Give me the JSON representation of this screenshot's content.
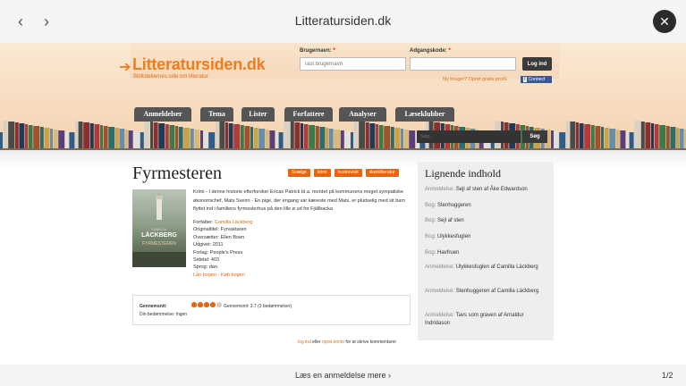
{
  "viewer": {
    "title": "Litteratursiden.dk",
    "prev_icon": "‹",
    "next_icon": "›",
    "close_icon": "✕",
    "bottom_link": "Læs en anmeldelse mere ›",
    "page_counter": "1/2"
  },
  "header": {
    "logo": "Litteratursiden.dk",
    "logo_arrow": "➔",
    "tagline": "Bibliotekernes side om litteratur",
    "username_label": "Brugernavn:",
    "username_placeholder": "Tast brugernavn",
    "password_label": "Adgangskode:",
    "required_mark": "*",
    "login_button": "Log ind",
    "new_user_link": "Ny bruger? Opret gratis profil.",
    "facebook_label": "f",
    "facebook_text": "Connect",
    "search_placeholder": "Søg...",
    "search_button": "Søg"
  },
  "menu": {
    "tabs": [
      "Anmeldelser",
      "Tema",
      "Lister",
      "Forfattere",
      "Analyser",
      "Læseklubber"
    ]
  },
  "book": {
    "title": "Fyrmesteren",
    "tags": [
      "Svælge",
      "krimi",
      "hustrevold",
      "skønlitteratur"
    ],
    "cover_firstname": "CAMILLA",
    "cover_author": "LÄCKBERG",
    "cover_title": "FYRMESTEREN",
    "description": "Krimi - I denne historie efterforsker Ericas Patrick bl.a. mordet på kommunens meget sympatiske økonomichef, Mats Sverin - En pige, der engang var kæreste med Mats, er pludselig med sit barn flyttet ind i familiens fyrmesterhus på den lille ø ud for Fjällbacka",
    "meta": [
      {
        "label": "Forfatter:",
        "value": "Camilla Läckberg",
        "link": true
      },
      {
        "label": "Originaltitel:",
        "value": "Fyrvaktaren",
        "link": false
      },
      {
        "label": "Oversætter:",
        "value": "Ellen Boen",
        "link": false
      },
      {
        "label": "Udgivet:",
        "value": "2011",
        "link": false
      },
      {
        "label": "Forlag:",
        "value": "People's Press",
        "link": false
      },
      {
        "label": "Sidetal:",
        "value": "403",
        "link": false
      },
      {
        "label": "Sprog:",
        "value": "dan",
        "link": false
      }
    ],
    "borrow_link": "Lån bogen",
    "separator": " - ",
    "buy_link": "Køb bogen"
  },
  "rating": {
    "label": "Gennemsnit:",
    "stars_filled": 4,
    "stars_total": 5,
    "average_text": "Gennemsnit: 3.7 (3 bedømmelser)",
    "no_rating_text": "Din bedømmelse: Ingen"
  },
  "comment_note": {
    "login_link": "log ind",
    "middle": " eller ",
    "create_link": "opret konto",
    "tail": " for at skrive kommentarer"
  },
  "sidebar": {
    "title": "Lignende indhold",
    "items": [
      {
        "kind": "Anmeldelse:",
        "text": "Sejl af sten af Åke Edwardson"
      },
      {
        "kind": "Bog:",
        "text": "Stenhuggeren"
      },
      {
        "kind": "Bog:",
        "text": "Sejl af sten"
      },
      {
        "kind": "Bog:",
        "text": "Ulykkesfuglen"
      },
      {
        "kind": "Bog:",
        "text": "Havfruen"
      },
      {
        "kind": "Anmeldelse:",
        "text": "Ulykkesfuglen af Camilla Läckberg"
      },
      {
        "kind": "Anmeldelse:",
        "text": "Stenhuggeren af Camilla Läckberg"
      },
      {
        "kind": "Anmeldelse:",
        "text": "Tavs som graven af Arnaldur Indridason"
      }
    ]
  },
  "colors": {
    "accent": "#e8650f",
    "tab_bg": "#555555",
    "facebook": "#3b5998"
  }
}
